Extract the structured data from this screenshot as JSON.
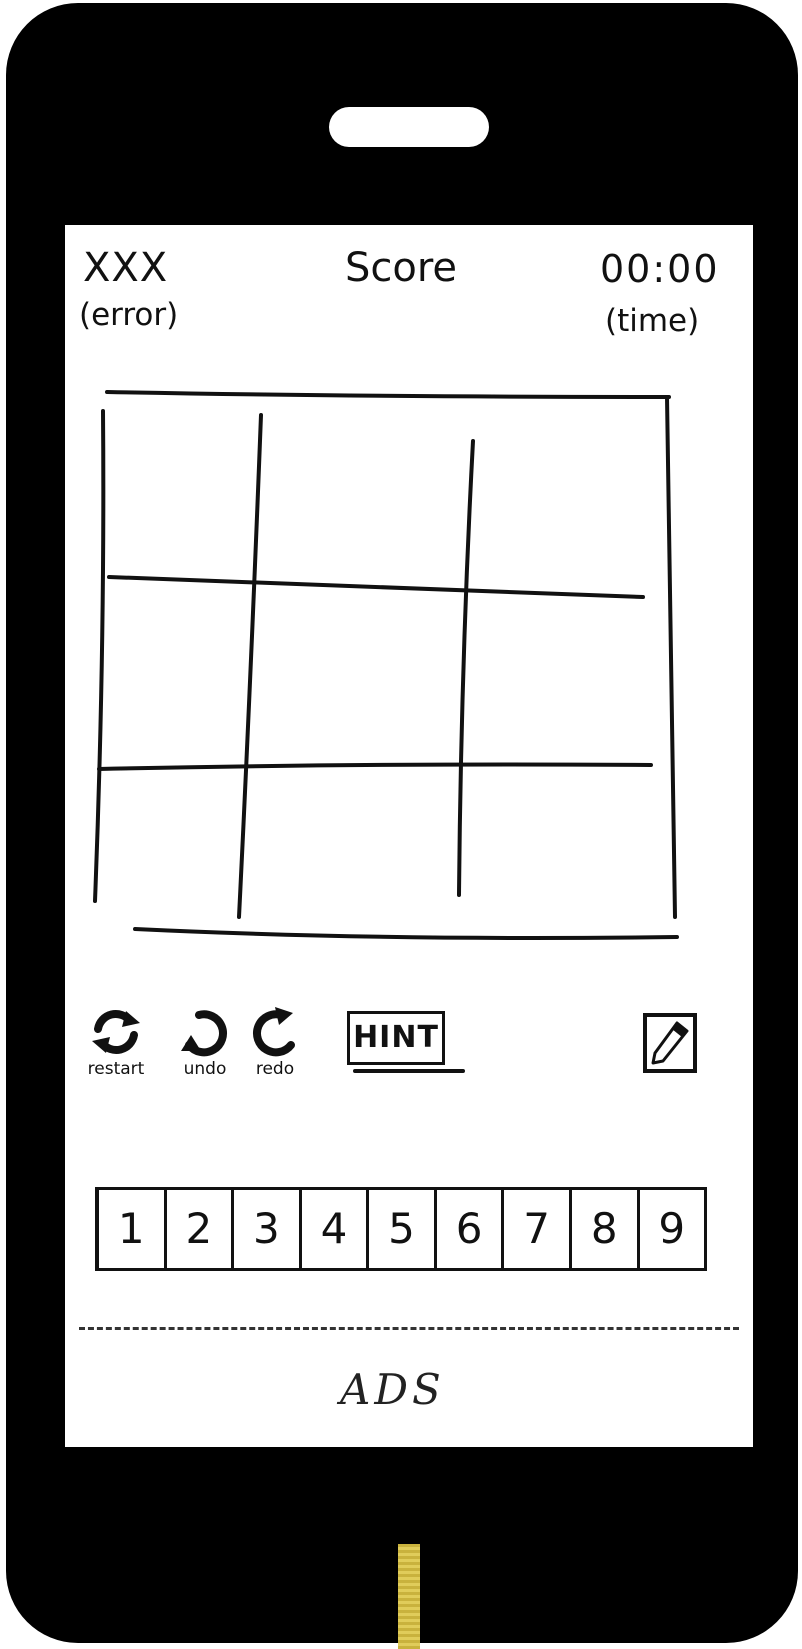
{
  "header": {
    "errors_count": "XXX",
    "errors_label": "(error)",
    "score_label": "Score",
    "time_value": "00:00",
    "time_label": "(time)"
  },
  "board": {
    "rows": 3,
    "cols": 3,
    "cells": [
      [
        "",
        "",
        ""
      ],
      [
        "",
        "",
        ""
      ],
      [
        "",
        "",
        ""
      ]
    ]
  },
  "toolbar": {
    "restart_label": "restart",
    "undo_label": "undo",
    "redo_label": "redo",
    "hint_label": "HINT",
    "pencil_icon": "pencil-icon"
  },
  "number_pad": [
    "1",
    "2",
    "3",
    "4",
    "5",
    "6",
    "7",
    "8",
    "9"
  ],
  "ads": {
    "label": "ADS"
  },
  "colors": {
    "phone_body": "#000000",
    "screen": "#ffffff",
    "home_button": "#d8c14a",
    "ink": "#111111"
  }
}
